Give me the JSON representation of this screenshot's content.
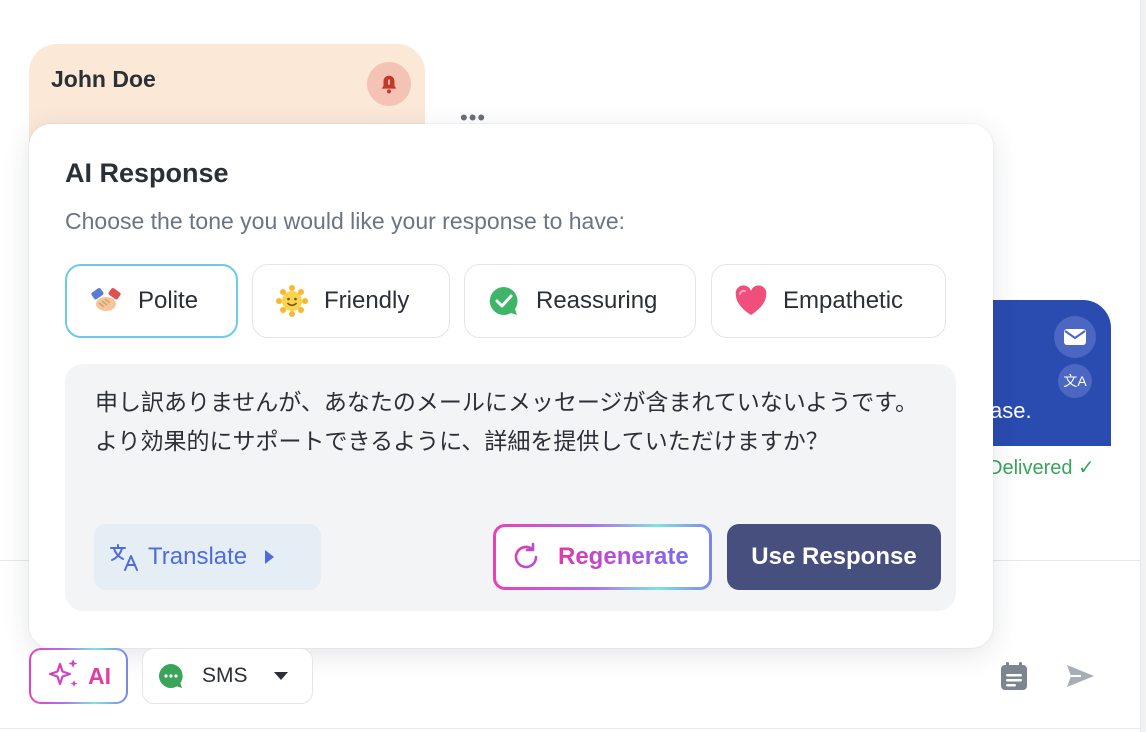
{
  "contact": {
    "name": "John Doe"
  },
  "message": {
    "text_fragment": "ase.",
    "status": "Delivered"
  },
  "popup": {
    "title": "AI Response",
    "subtitle": "Choose the tone you would like your response to have:",
    "tones": [
      {
        "label": "Polite",
        "icon": "handshake-icon",
        "selected": true
      },
      {
        "label": "Friendly",
        "icon": "smiling-sun-icon",
        "selected": false
      },
      {
        "label": "Reassuring",
        "icon": "check-bubble-icon",
        "selected": false
      },
      {
        "label": "Empathetic",
        "icon": "heart-icon",
        "selected": false
      }
    ],
    "response_text": "申し訳ありませんが、あなたのメールにメッセージが含まれていないようです。より効果的にサポートできるように、詳細を提供していただけますか？",
    "translate_label": "Translate",
    "regenerate_label": "Regenerate",
    "use_response_label": "Use Response"
  },
  "toolbar": {
    "ai_label": "AI",
    "channel_label": "SMS"
  },
  "colors": {
    "accent_pink": "#e23aa7",
    "selected_border": "#6ccbe6",
    "primary_button": "#474f7e",
    "message_bubble": "#2a4bb0",
    "delivered": "#3aa45b"
  }
}
